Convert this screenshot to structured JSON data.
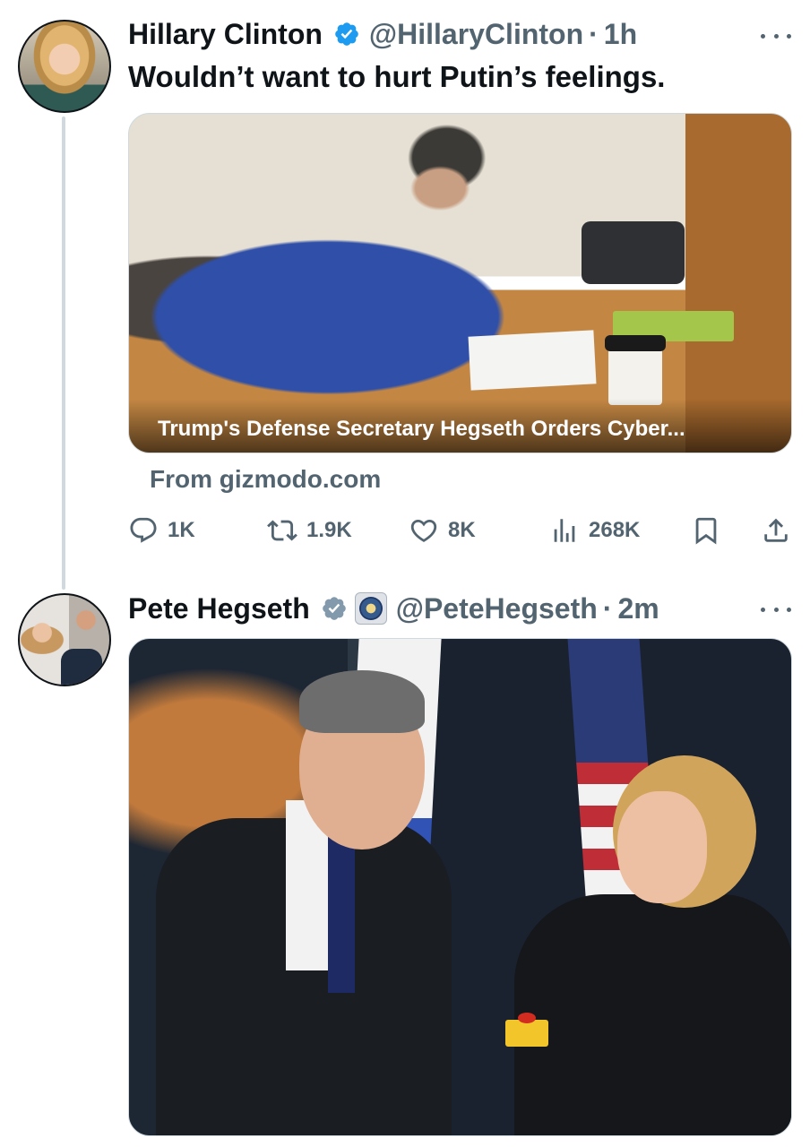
{
  "tweets": [
    {
      "name": "Hillary Clinton",
      "handle": "@HillaryClinton",
      "separator": "·",
      "time": "1h",
      "text": "Wouldn’t want to hurt Putin’s feelings.",
      "card": {
        "caption": "Trump's Defense Secretary Hegseth Orders Cyber...",
        "source": "From gizmodo.com"
      },
      "actions": {
        "replies": "1K",
        "reposts": "1.9K",
        "likes": "8K",
        "views": "268K"
      }
    },
    {
      "name": "Pete Hegseth",
      "handle": "@PeteHegseth",
      "separator": "·",
      "time": "2m"
    }
  ],
  "icons": {
    "verified": "verified-badge-icon",
    "government": "government-affiliation-badge-icon",
    "more": "more-options-icon",
    "reply": "reply-icon",
    "repost": "repost-icon",
    "like": "heart-icon",
    "views": "views-chart-icon",
    "bookmark": "bookmark-icon",
    "share": "share-icon"
  },
  "colors": {
    "verified_blue": "#1d9bf0",
    "verified_gray": "#829aab",
    "secondary_text": "#536471",
    "thread_line": "#cfd9de"
  }
}
